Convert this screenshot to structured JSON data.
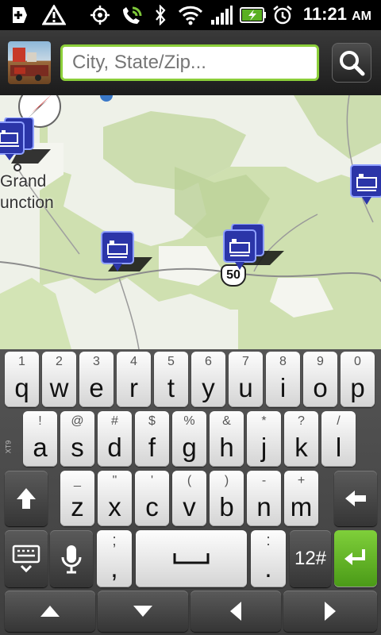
{
  "status_bar": {
    "time": "11:21",
    "ampm": "AM",
    "icons": [
      "add-notification-icon",
      "warning-icon",
      "gps-icon",
      "phone-sync-icon",
      "bluetooth-icon",
      "wifi-icon",
      "signal-icon",
      "battery-charging-icon",
      "alarm-icon"
    ]
  },
  "search": {
    "placeholder": "City, State/Zip..."
  },
  "map": {
    "labels": {
      "city_line1": "Grand",
      "city_line2": "unction",
      "route": "50"
    },
    "markers": [
      "hotel-marker",
      "hotel-marker",
      "hotel-marker",
      "hotel-marker",
      "hotel-marker"
    ],
    "colors": {
      "marker": "#2b35a8",
      "forest": "#cfe0b0",
      "land": "#eef1e8"
    }
  },
  "keyboard": {
    "row1": [
      {
        "num": "1",
        "letter": "q"
      },
      {
        "num": "2",
        "letter": "w"
      },
      {
        "num": "3",
        "letter": "e"
      },
      {
        "num": "4",
        "letter": "r"
      },
      {
        "num": "5",
        "letter": "t"
      },
      {
        "num": "6",
        "letter": "y"
      },
      {
        "num": "7",
        "letter": "u"
      },
      {
        "num": "8",
        "letter": "i"
      },
      {
        "num": "9",
        "letter": "o"
      },
      {
        "num": "0",
        "letter": "p"
      }
    ],
    "row2": [
      {
        "num": "!",
        "letter": "a"
      },
      {
        "num": "@",
        "letter": "s"
      },
      {
        "num": "#",
        "letter": "d"
      },
      {
        "num": "$",
        "letter": "f"
      },
      {
        "num": "%",
        "letter": "g"
      },
      {
        "num": "&",
        "letter": "h"
      },
      {
        "num": "*",
        "letter": "j"
      },
      {
        "num": "?",
        "letter": "k"
      },
      {
        "num": "/",
        "letter": "l"
      }
    ],
    "row3": [
      {
        "num": "_",
        "letter": "z"
      },
      {
        "num": "\"",
        "letter": "x"
      },
      {
        "num": "'",
        "letter": "c"
      },
      {
        "num": "(",
        "letter": "v"
      },
      {
        "num": ")",
        "letter": "b"
      },
      {
        "num": "-",
        "letter": "n"
      },
      {
        "num": "+",
        "letter": "m"
      }
    ],
    "comma_top": ";",
    "comma": ",",
    "period_top": ":",
    "period": ".",
    "symbols_label": "12#",
    "side_label": "XT9"
  },
  "colors": {
    "accent_green": "#8ccf3a",
    "enter_green": "#5ab022"
  }
}
